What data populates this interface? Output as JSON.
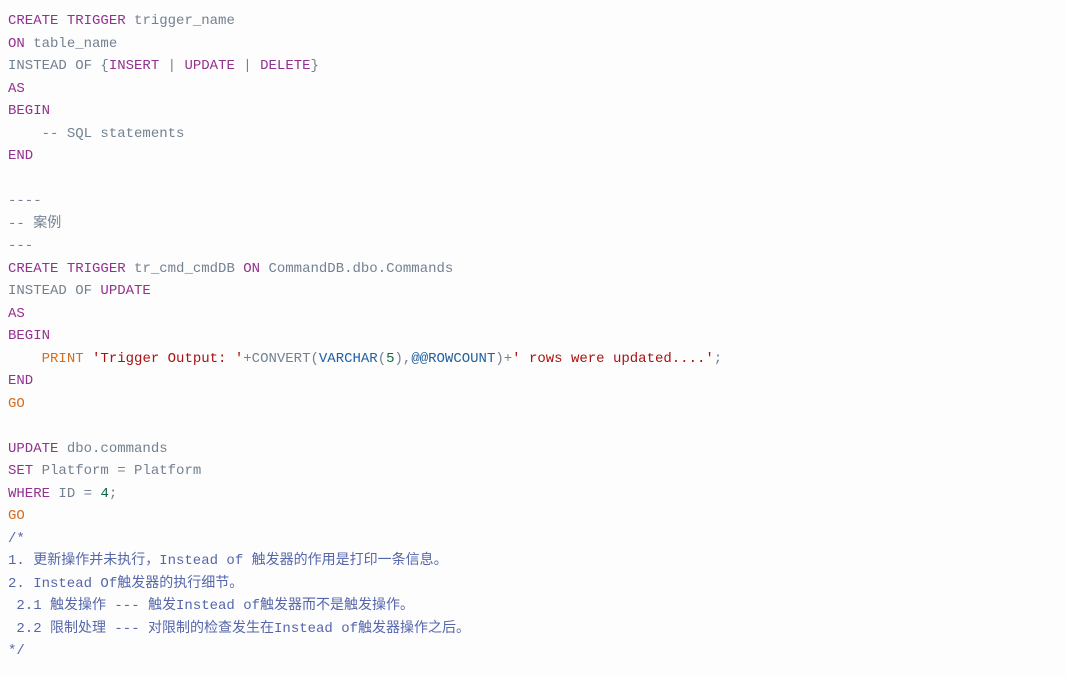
{
  "code": {
    "lines": [
      {
        "tokens": [
          {
            "t": "CREATE",
            "c": "kw"
          },
          {
            "t": " ",
            "c": ""
          },
          {
            "t": "TRIGGER",
            "c": "kw"
          },
          {
            "t": " trigger_name",
            "c": "gray"
          }
        ]
      },
      {
        "tokens": [
          {
            "t": "ON",
            "c": "kw"
          },
          {
            "t": " table_name",
            "c": "gray"
          }
        ]
      },
      {
        "tokens": [
          {
            "t": "INSTEAD OF {",
            "c": "gray"
          },
          {
            "t": "INSERT",
            "c": "kw"
          },
          {
            "t": " | ",
            "c": "gray"
          },
          {
            "t": "UPDATE",
            "c": "kw"
          },
          {
            "t": " | ",
            "c": "gray"
          },
          {
            "t": "DELETE",
            "c": "kw"
          },
          {
            "t": "}",
            "c": "gray"
          }
        ]
      },
      {
        "tokens": [
          {
            "t": "AS",
            "c": "kw"
          }
        ]
      },
      {
        "tokens": [
          {
            "t": "BEGIN",
            "c": "kw"
          }
        ]
      },
      {
        "tokens": [
          {
            "t": "    ",
            "c": ""
          },
          {
            "t": "-- SQL statements",
            "c": "comment"
          }
        ]
      },
      {
        "tokens": [
          {
            "t": "END",
            "c": "kw"
          }
        ]
      },
      {
        "tokens": [
          {
            "t": "",
            "c": ""
          }
        ]
      },
      {
        "tokens": [
          {
            "t": "----",
            "c": "comment"
          }
        ]
      },
      {
        "tokens": [
          {
            "t": "-- 案例",
            "c": "comment"
          }
        ]
      },
      {
        "tokens": [
          {
            "t": "---",
            "c": "comment"
          }
        ]
      },
      {
        "tokens": [
          {
            "t": "CREATE",
            "c": "kw"
          },
          {
            "t": " ",
            "c": ""
          },
          {
            "t": "TRIGGER",
            "c": "kw"
          },
          {
            "t": " tr_cmd_cmdDB ",
            "c": "gray"
          },
          {
            "t": "ON",
            "c": "kw"
          },
          {
            "t": " CommandDB.dbo.Commands",
            "c": "gray"
          }
        ]
      },
      {
        "tokens": [
          {
            "t": "INSTEAD OF ",
            "c": "gray"
          },
          {
            "t": "UPDATE",
            "c": "kw"
          }
        ]
      },
      {
        "tokens": [
          {
            "t": "AS",
            "c": "kw"
          }
        ]
      },
      {
        "tokens": [
          {
            "t": "BEGIN",
            "c": "kw"
          }
        ]
      },
      {
        "tokens": [
          {
            "t": "    ",
            "c": ""
          },
          {
            "t": "PRINT",
            "c": "orange"
          },
          {
            "t": " ",
            "c": ""
          },
          {
            "t": "'Trigger Output: '",
            "c": "str"
          },
          {
            "t": "+",
            "c": "gray"
          },
          {
            "t": "CONVERT",
            "c": "gray"
          },
          {
            "t": "(",
            "c": "gray"
          },
          {
            "t": "VARCHAR",
            "c": "func-blue"
          },
          {
            "t": "(",
            "c": "gray"
          },
          {
            "t": "5",
            "c": "num"
          },
          {
            "t": "),",
            "c": "gray"
          },
          {
            "t": "@@ROWCOUNT",
            "c": "rowcount"
          },
          {
            "t": ")",
            "c": "gray"
          },
          {
            "t": "+",
            "c": "gray"
          },
          {
            "t": "' rows were updated....'",
            "c": "str"
          },
          {
            "t": ";",
            "c": "gray"
          }
        ]
      },
      {
        "tokens": [
          {
            "t": "END",
            "c": "kw"
          }
        ]
      },
      {
        "tokens": [
          {
            "t": "GO",
            "c": "orange"
          }
        ]
      },
      {
        "tokens": [
          {
            "t": "",
            "c": ""
          }
        ]
      },
      {
        "tokens": [
          {
            "t": "UPDATE",
            "c": "kw"
          },
          {
            "t": " dbo.commands",
            "c": "gray"
          }
        ]
      },
      {
        "tokens": [
          {
            "t": "SET",
            "c": "kw"
          },
          {
            "t": " Platform ",
            "c": "gray"
          },
          {
            "t": "=",
            "c": "gray"
          },
          {
            "t": " Platform",
            "c": "gray"
          }
        ]
      },
      {
        "tokens": [
          {
            "t": "WHERE",
            "c": "kw"
          },
          {
            "t": " ID ",
            "c": "gray"
          },
          {
            "t": "=",
            "c": "gray"
          },
          {
            "t": " ",
            "c": ""
          },
          {
            "t": "4",
            "c": "num"
          },
          {
            "t": ";",
            "c": "gray"
          }
        ]
      },
      {
        "tokens": [
          {
            "t": "GO",
            "c": "orange"
          }
        ]
      },
      {
        "tokens": [
          {
            "t": "/*",
            "c": "signal"
          }
        ]
      },
      {
        "tokens": [
          {
            "t": "1. 更新操作并未执行，Instead of 触发器的作用是打印一条信息。",
            "c": "signal"
          }
        ]
      },
      {
        "tokens": [
          {
            "t": "2. Instead Of触发器的执行细节。",
            "c": "signal"
          }
        ]
      },
      {
        "tokens": [
          {
            "t": " 2.1 触发操作 --- 触发Instead of触发器而不是触发操作。",
            "c": "signal"
          }
        ]
      },
      {
        "tokens": [
          {
            "t": " 2.2 限制处理 --- 对限制的检查发生在Instead of触发器操作之后。",
            "c": "signal"
          }
        ]
      },
      {
        "tokens": [
          {
            "t": "*/",
            "c": "signal"
          }
        ]
      }
    ]
  }
}
